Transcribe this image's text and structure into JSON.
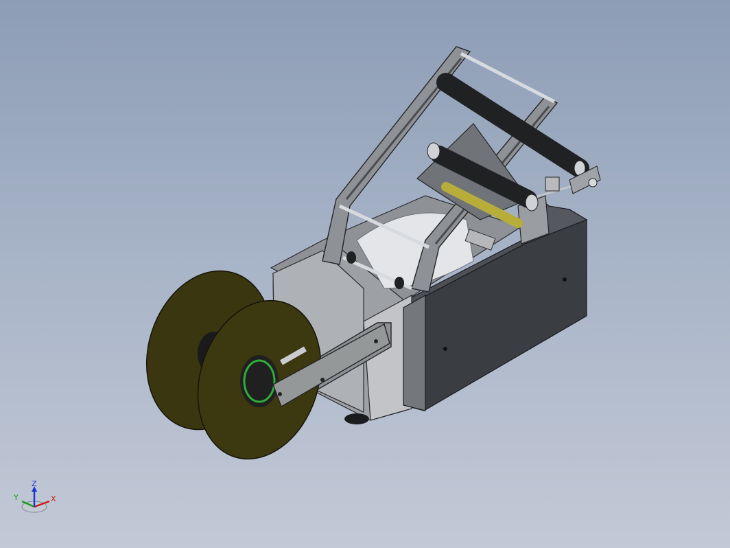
{
  "viewport": {
    "background_top": "#8d9db6",
    "background_bottom": "#c3c9d6"
  },
  "model": {
    "colors": {
      "housing_dark": "#3d4045",
      "housing_mid": "#5a5e64",
      "frame_gray": "#8e9196",
      "plate_light": "#b9bbbe",
      "reel_olive": "#3e3a10",
      "reel_olive_light": "#57511a",
      "roller_black": "#1f2123",
      "label_yellow": "#b7ad3a",
      "spool_white": "#e4e6ea",
      "accent_green": "#2fae3a"
    }
  },
  "triad": {
    "x_label": "X",
    "y_label": "Y",
    "z_label": "Z",
    "x_color": "#d01818",
    "y_color": "#18a018",
    "z_color": "#1838d0"
  }
}
